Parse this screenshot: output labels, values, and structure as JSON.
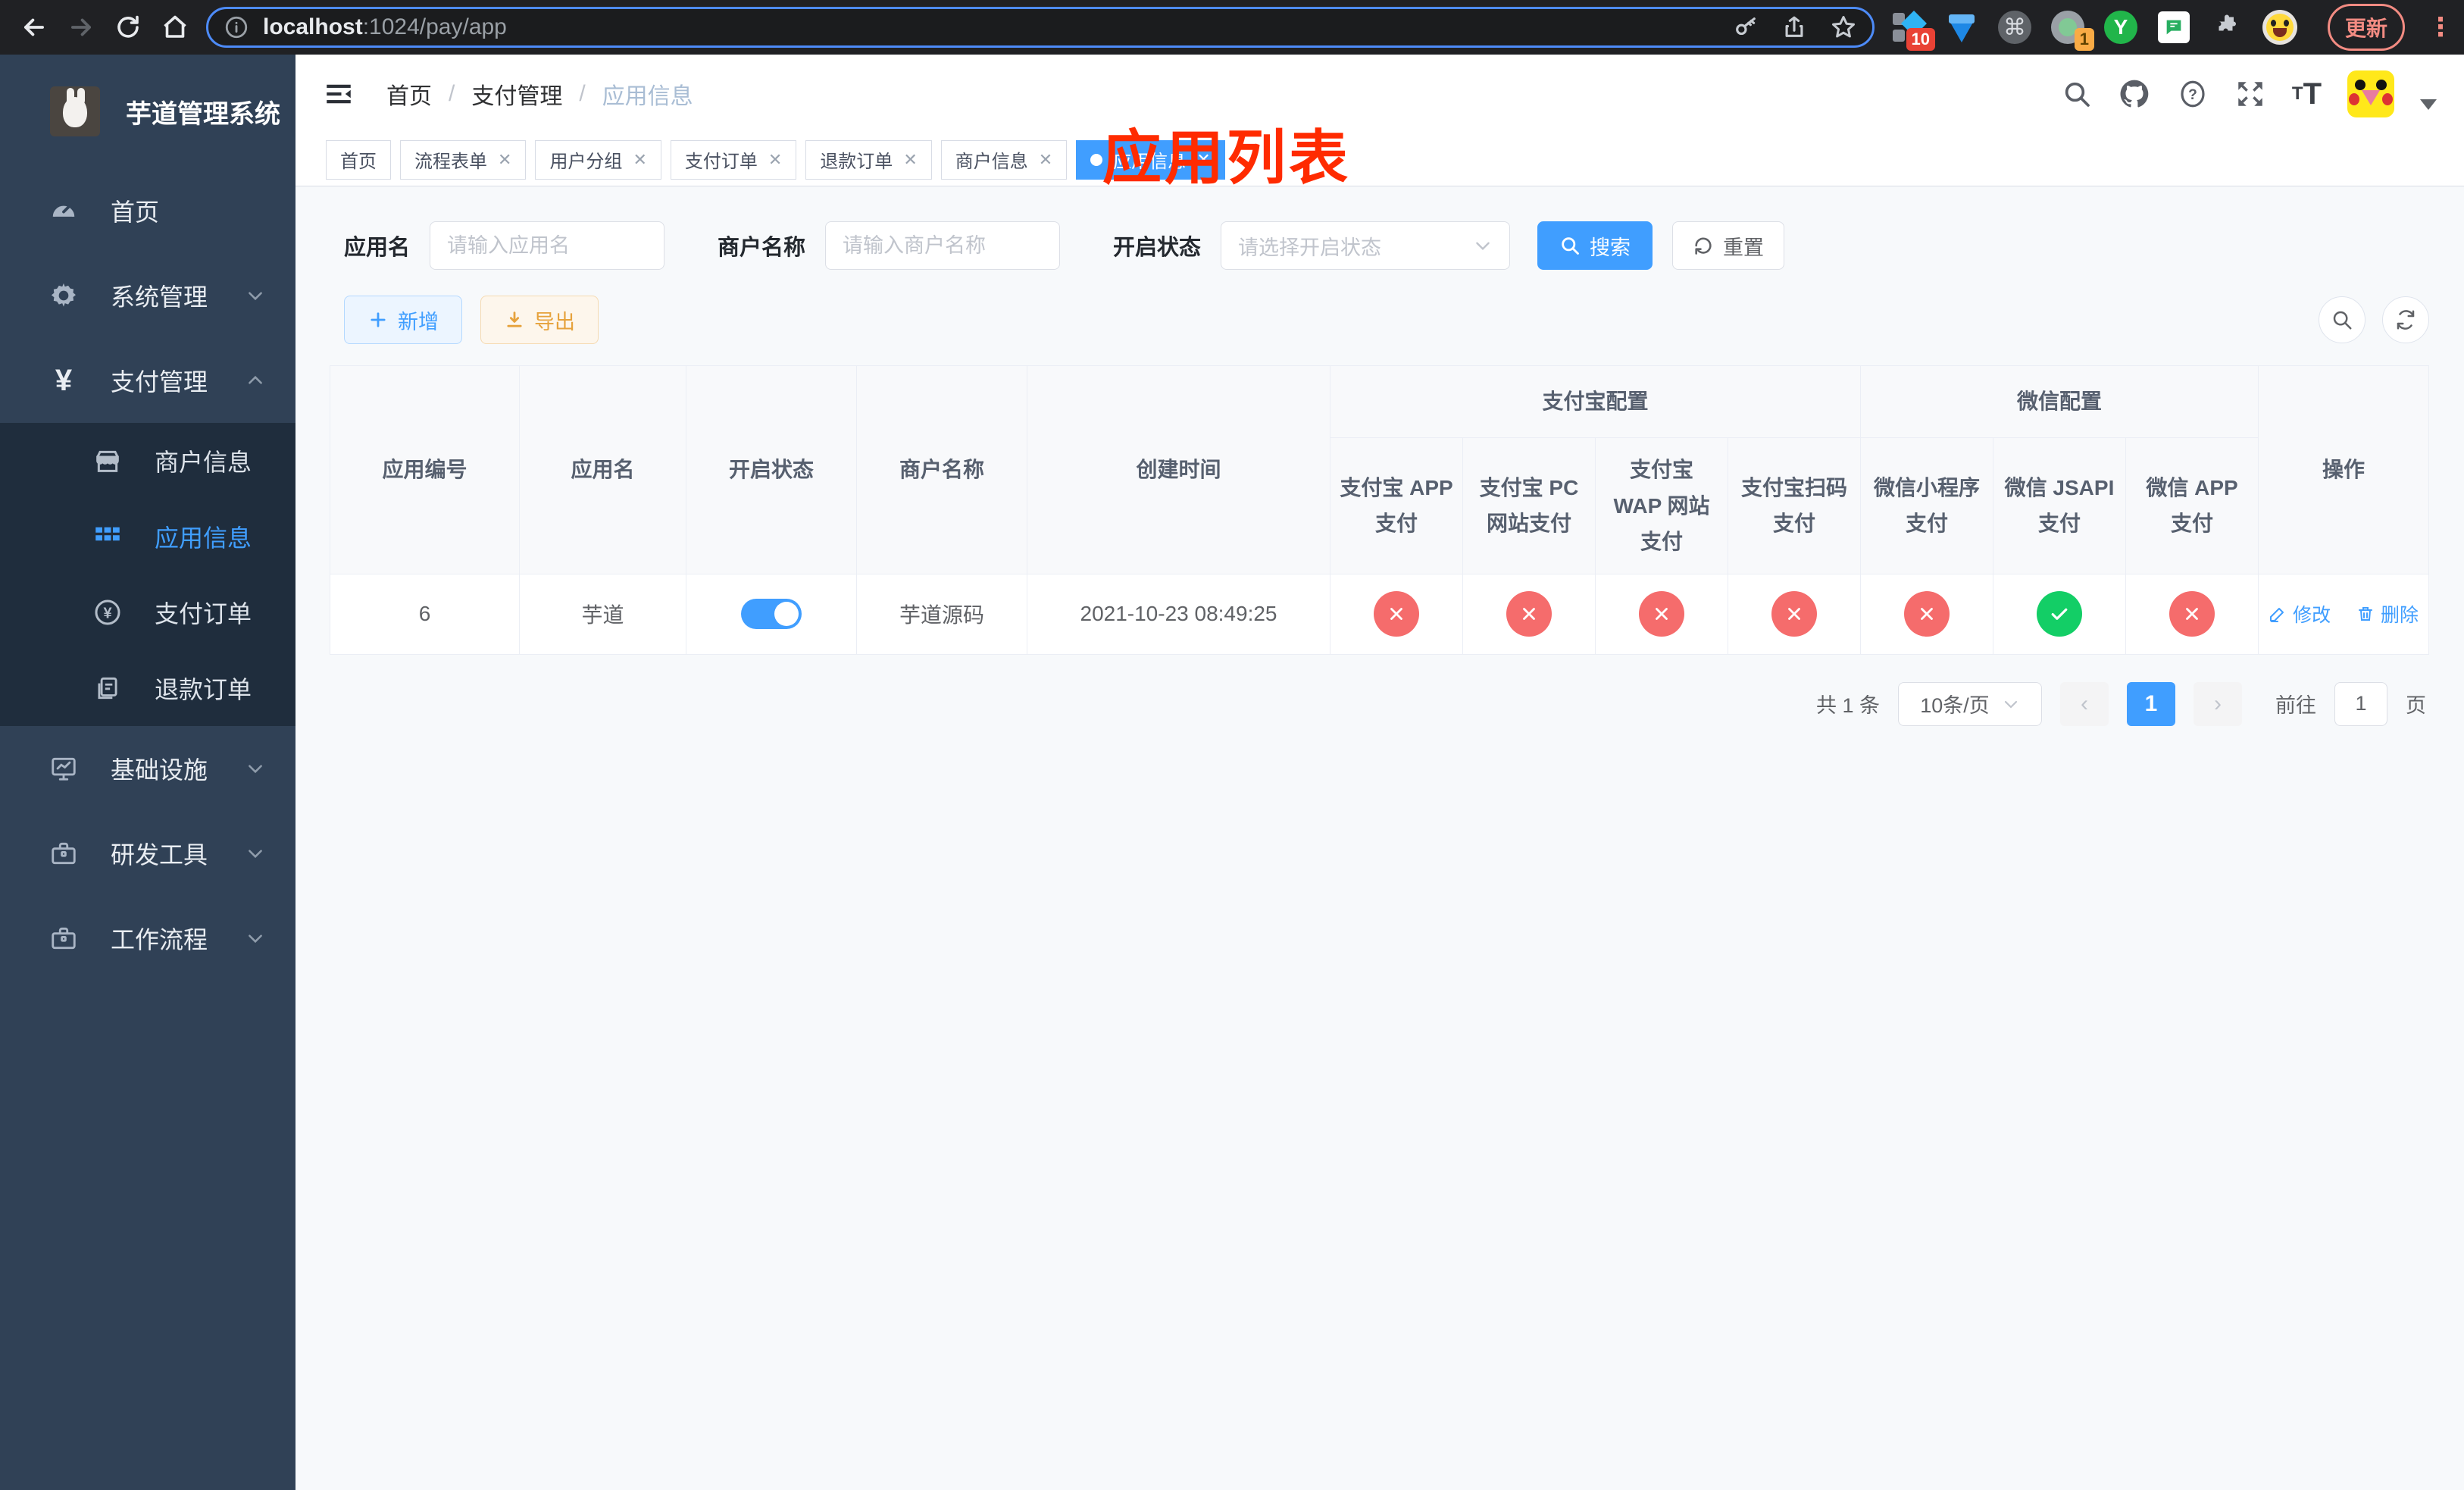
{
  "browser": {
    "url_host": "localhost",
    "url_rest": ":1024/pay/app",
    "update_label": "更新",
    "ext_badge_pin": "10",
    "ext_badge_rec": "1",
    "ext_y_letter": "Y"
  },
  "sidebar": {
    "title": "芋道管理系统",
    "items": [
      {
        "label": "首页"
      },
      {
        "label": "系统管理"
      },
      {
        "label": "支付管理"
      }
    ],
    "submenu": [
      {
        "label": "商户信息"
      },
      {
        "label": "应用信息"
      },
      {
        "label": "支付订单"
      },
      {
        "label": "退款订单"
      }
    ],
    "items_bottom": [
      {
        "label": "基础设施"
      },
      {
        "label": "研发工具"
      },
      {
        "label": "工作流程"
      }
    ]
  },
  "header": {
    "breadcrumb": [
      "首页",
      "支付管理",
      "应用信息"
    ],
    "annotation": "应用列表"
  },
  "tabs": [
    {
      "label": "首页"
    },
    {
      "label": "流程表单"
    },
    {
      "label": "用户分组"
    },
    {
      "label": "支付订单"
    },
    {
      "label": "退款订单"
    },
    {
      "label": "商户信息"
    },
    {
      "label": "应用信息"
    }
  ],
  "filters": {
    "app_name_label": "应用名",
    "app_name_placeholder": "请输入应用名",
    "merchant_label": "商户名称",
    "merchant_placeholder": "请输入商户名称",
    "status_label": "开启状态",
    "status_placeholder": "请选择开启状态",
    "search_label": "搜索",
    "reset_label": "重置"
  },
  "actions": {
    "add_label": "新增",
    "export_label": "导出"
  },
  "table": {
    "columns": {
      "id": "应用编号",
      "name": "应用名",
      "status": "开启状态",
      "merchant": "商户名称",
      "created": "创建时间",
      "alipay_group": "支付宝配置",
      "wechat_group": "微信配置",
      "ops": "操作",
      "alipay": [
        "支付宝 APP 支付",
        "支付宝 PC 网站支付",
        "支付宝 WAP 网站支付",
        "支付宝扫码支付"
      ],
      "wechat": [
        "微信小程序支付",
        "微信 JSAPI 支付",
        "微信 APP 支付"
      ]
    },
    "row": {
      "id": "6",
      "name": "芋道",
      "enabled": true,
      "merchant": "芋道源码",
      "created": "2021-10-23 08:49:25",
      "channels": [
        "no",
        "no",
        "no",
        "no",
        "no",
        "yes",
        "no"
      ],
      "edit_label": "修改",
      "delete_label": "删除"
    }
  },
  "pagination": {
    "total": "共 1 条",
    "page_size": "10条/页",
    "prev": "‹",
    "page": "1",
    "next": "›",
    "goto_label": "前往",
    "goto_value": "1",
    "page_unit": "页"
  },
  "colors": {
    "accent": "#409eff",
    "success": "#13ce66",
    "danger": "#f56c6c"
  }
}
